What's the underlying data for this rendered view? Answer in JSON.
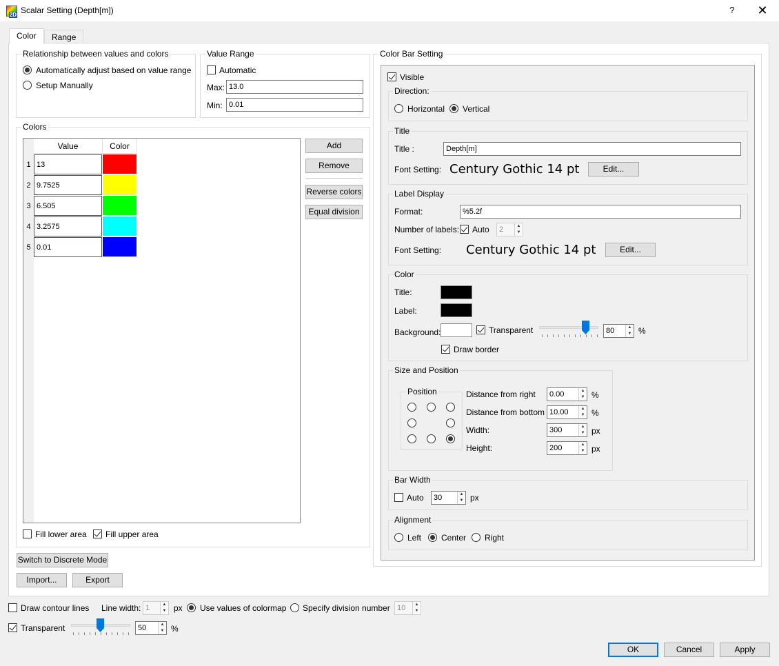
{
  "window": {
    "title": "Scalar Setting (Depth[m])",
    "help": "?",
    "close": "✕"
  },
  "tabs": [
    {
      "label": "Color"
    },
    {
      "label": "Range"
    }
  ],
  "relationship": {
    "title": "Relationship between values and colors",
    "auto_label": "Automatically adjust based on value range",
    "manual_label": "Setup Manually",
    "selected": "auto"
  },
  "value_range": {
    "title": "Value Range",
    "automatic_label": "Automatic",
    "automatic": false,
    "max_label": "Max:",
    "max": "13.0",
    "min_label": "Min:",
    "min": "0.01"
  },
  "colors": {
    "title": "Colors",
    "headers": {
      "value": "Value",
      "color": "Color"
    },
    "rows": [
      {
        "index": "1",
        "value": "13",
        "color": "#ff0000"
      },
      {
        "index": "2",
        "value": "9.7525",
        "color": "#ffff00"
      },
      {
        "index": "3",
        "value": "6.505",
        "color": "#00ff00"
      },
      {
        "index": "4",
        "value": "3.2575",
        "color": "#00ffff"
      },
      {
        "index": "5",
        "value": "0.01",
        "color": "#0000ff"
      }
    ],
    "add": "Add",
    "remove": "Remove",
    "reverse": "Reverse colors",
    "equal": "Equal division",
    "fill_lower": "Fill lower area",
    "fill_lower_checked": false,
    "fill_upper": "Fill upper area",
    "fill_upper_checked": true
  },
  "discrete_button": "Switch to Discrete Mode",
  "import_button": "Import...",
  "export_button": "Export",
  "colorbar": {
    "title": "Color Bar Setting",
    "visible_label": "Visible",
    "visible": true,
    "direction": {
      "title": "Direction:",
      "horizontal": "Horizontal",
      "vertical": "Vertical",
      "selected": "vertical"
    },
    "title_group": {
      "title": "Title",
      "title_label": "Title :",
      "title_value": "Depth[m]",
      "font_label": "Font Setting:",
      "font_value": "Century Gothic 14 pt",
      "edit": "Edit..."
    },
    "label_display": {
      "title": "Label Display",
      "format_label": "Format:",
      "format_value": "%5.2f",
      "num_labels": "Number of labels:",
      "auto_label": "Auto",
      "auto": true,
      "count": "2",
      "font_label": "Font Setting:",
      "font_value": "Century Gothic 14 pt",
      "edit": "Edit..."
    },
    "color_group": {
      "title": "Color",
      "title_label": "Title:",
      "title_color": "#000000",
      "label_label": "Label:",
      "label_color": "#000000",
      "background_label": "Background:",
      "background_color": "#ffffff",
      "transparent_label": "Transparent",
      "transparent": true,
      "transparency": "80",
      "percent": "%",
      "draw_border_label": "Draw border",
      "draw_border": true
    },
    "size_position": {
      "title": "Size and Position",
      "position_title": "Position",
      "selected_position": "bottom-right",
      "dist_right_label": "Distance from right",
      "dist_right": "0.00",
      "dist_bottom_label": "Distance from bottom",
      "dist_bottom": "10.00",
      "width_label": "Width:",
      "width": "300",
      "height_label": "Height:",
      "height": "200",
      "pct": "%",
      "px": "px"
    },
    "bar_width": {
      "title": "Bar Width",
      "auto_label": "Auto",
      "auto": false,
      "value": "30",
      "unit": "px"
    },
    "alignment": {
      "title": "Alignment",
      "left": "Left",
      "center": "Center",
      "right": "Right",
      "selected": "center"
    }
  },
  "bottom": {
    "contour_label": "Draw contour lines",
    "contour": false,
    "line_width_label": "Line width:",
    "line_width": "1",
    "px": "px",
    "use_colormap": "Use values of colormap",
    "specify_division": "Specify division number",
    "division_value": "10",
    "selected": "colormap",
    "transparent_label": "Transparent",
    "transparent": true,
    "transparency": "50",
    "percent": "%"
  },
  "footer": {
    "ok": "OK",
    "cancel": "Cancel",
    "apply": "Apply"
  }
}
